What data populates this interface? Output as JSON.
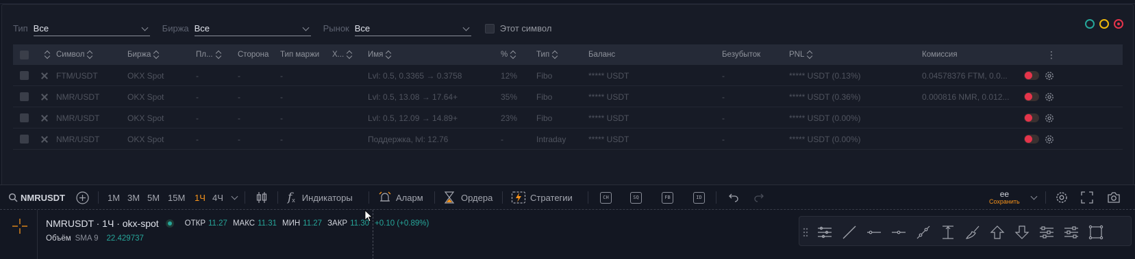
{
  "filters": {
    "type": {
      "label": "Тип",
      "value": "Все"
    },
    "exchange": {
      "label": "Биржа",
      "value": "Все"
    },
    "market": {
      "label": "Рынок",
      "value": "Все"
    },
    "this_symbol": "Этот символ"
  },
  "window_dots": {
    "green": "#26a69a",
    "yellow": "#f0b90b",
    "red": "#e5344b"
  },
  "table": {
    "headers": {
      "symbol": "Символ",
      "exchange": "Биржа",
      "pl": "Пл...",
      "side": "Сторона",
      "margin_type": "Тип маржи",
      "x": "Х...",
      "name": "Имя",
      "pct": "%",
      "type": "Тип",
      "balance": "Баланс",
      "breakeven": "Безубыток",
      "pnl": "PNL",
      "commission": "Комиссия"
    },
    "rows": [
      {
        "symbol": "FTM/USDT",
        "exchange": "OKX Spot",
        "pl": "-",
        "side": "-",
        "margin": "-",
        "name": "Lvl: 0.5, 0.3365 → 0.3758",
        "pct": "12%",
        "type": "Fibo",
        "balance": "***** USDT",
        "breakeven": "-",
        "pnl": "***** USDT (0.13%)",
        "commission": "0.04578376 FTM, 0.0..."
      },
      {
        "symbol": "NMR/USDT",
        "exchange": "OKX Spot",
        "pl": "-",
        "side": "-",
        "margin": "-",
        "name": "Lvl: 0.5, 13.08 → 17.64+",
        "pct": "35%",
        "type": "Fibo",
        "balance": "***** USDT",
        "breakeven": "-",
        "pnl": "***** USDT (0.36%)",
        "commission": "0.000816 NMR, 0.012..."
      },
      {
        "symbol": "NMR/USDT",
        "exchange": "OKX Spot",
        "pl": "-",
        "side": "-",
        "margin": "-",
        "name": "Lvl: 0.5, 12.09 → 14.89+",
        "pct": "23%",
        "type": "Fibo",
        "balance": "***** USDT",
        "breakeven": "-",
        "pnl": "***** USDT (0.00%)",
        "commission": ""
      },
      {
        "symbol": "NMR/USDT",
        "exchange": "OKX Spot",
        "pl": "-",
        "side": "-",
        "margin": "-",
        "name": "Поддержка, lvl: 12.76",
        "pct": "-",
        "type": "Intraday",
        "balance": "***** USDT",
        "breakeven": "-",
        "pnl": "***** USDT (0.00%)",
        "commission": ""
      }
    ]
  },
  "toolbar": {
    "symbol": "NMRUSDT",
    "intervals": [
      "1M",
      "3M",
      "5M",
      "15M",
      "1Ч",
      "4Ч"
    ],
    "active_interval": "1Ч",
    "indicators": "Индикаторы",
    "alarm": "Аларм",
    "orders": "Ордера",
    "strategies": "Стратегии",
    "small_buttons": [
      "CH",
      "SQ",
      "FB",
      "ID"
    ],
    "layout_name": "ee",
    "save_label": "Сохранить"
  },
  "chart": {
    "title": "NMRUSDT · 1Ч · okx-spot",
    "open_label": "ОТКР",
    "open": "11.27",
    "high_label": "МАКС",
    "high": "11.31",
    "low_label": "МИН",
    "low": "11.27",
    "close_label": "ЗАКР",
    "close": "11.30",
    "change": "+0.10 (+0.89%)",
    "volume_label": "Объём",
    "sma_label": "SMA 9",
    "sma_value": "22.429737"
  }
}
